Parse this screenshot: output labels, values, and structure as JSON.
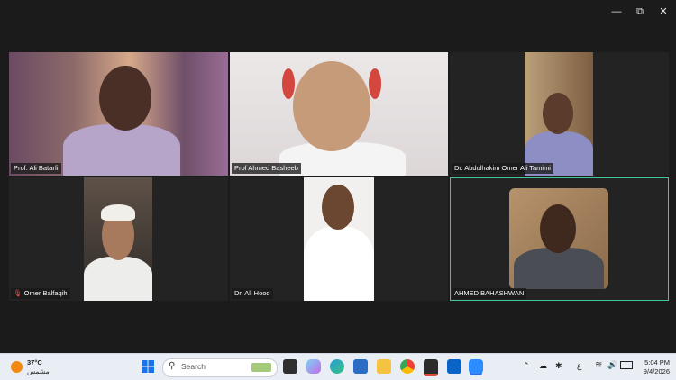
{
  "window": {
    "minimize_icon": "minimize-icon",
    "maximize_icon": "restore-icon",
    "close_icon": "close-icon"
  },
  "participants": [
    {
      "name": "Prof. Ali Batarfi"
    },
    {
      "name": "Prof Ahmed Basheeb"
    },
    {
      "name": "Dr. Abdulhakim Omer Ali Tamimi"
    },
    {
      "name": "Omer Balfaqih",
      "muted": true
    },
    {
      "name": "Dr. Ali Hood"
    },
    {
      "name": "AHMED BAHASHWAN",
      "active_speaker": true
    }
  ],
  "colors": {
    "active_border": "#3fc99a",
    "background": "#1b1b1b"
  },
  "taskbar": {
    "weather": {
      "temp": "37°C",
      "condition": "مشمس"
    },
    "search_placeholder": "Search",
    "apps": [
      "start-icon",
      "task-view-icon",
      "copilot-icon",
      "edge-icon",
      "store-icon",
      "file-explorer-icon",
      "chrome-icon",
      "photos-icon",
      "outlook-icon",
      "zoom-icon"
    ],
    "tray_icons": [
      "chevron-up-icon",
      "onedrive-icon",
      "bluetooth-icon",
      "keyboard-lang-icon",
      "wifi-icon",
      "volume-icon",
      "battery-icon"
    ],
    "lang": "ع",
    "time": "5:04 PM",
    "date": "9/4/2026"
  }
}
